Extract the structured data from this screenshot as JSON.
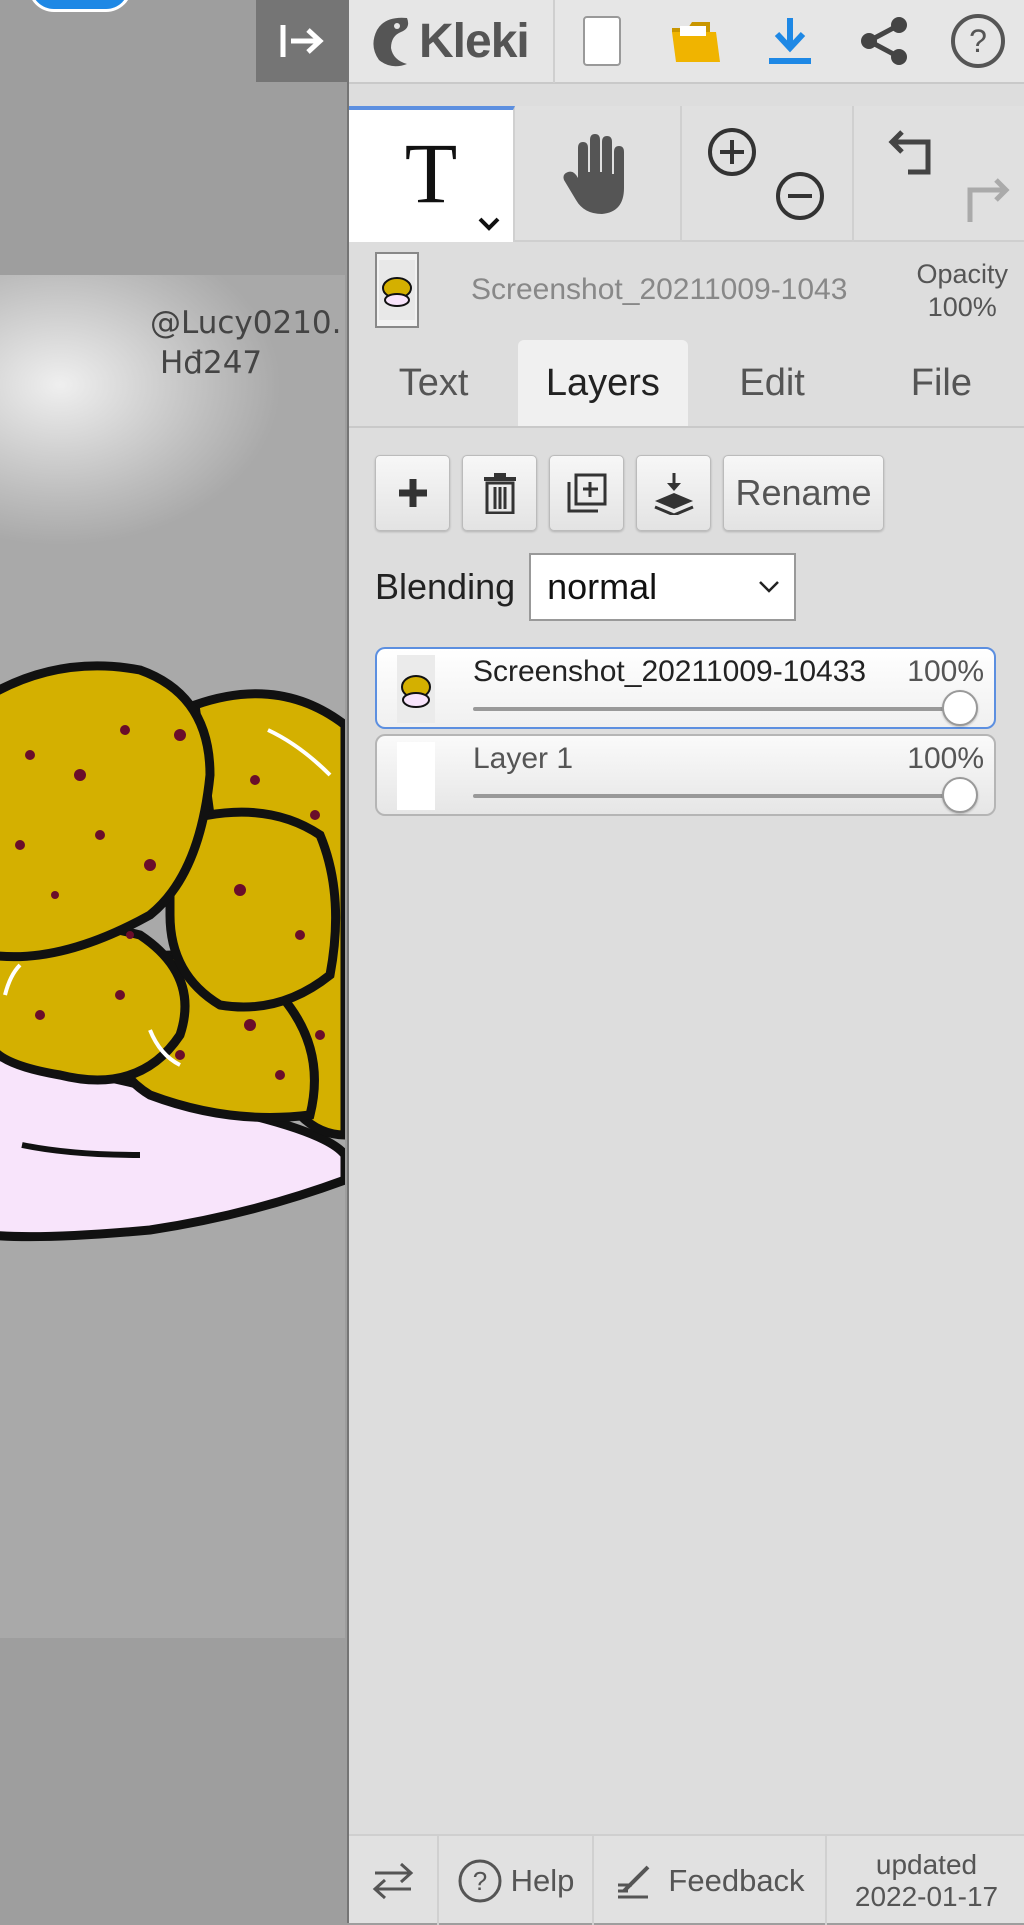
{
  "canvas": {
    "watermark_line1": "@Lucy0210.",
    "watermark_line2": "Hđ247"
  },
  "topbar": {
    "brand": "Kleki",
    "icons": [
      "new-image-icon",
      "open-folder-icon",
      "download-icon",
      "share-icon",
      "help-icon"
    ]
  },
  "tools": [
    "text-tool-icon",
    "hand-tool-icon",
    "zoom-in-icon",
    "zoom-out-icon",
    "undo-icon",
    "redo-icon"
  ],
  "tools_text_glyph": "T",
  "layer_header": {
    "name": "Screenshot_20211009-1043",
    "opacity_label": "Opacity",
    "opacity_value": "100%"
  },
  "tabs": [
    {
      "label": "Text",
      "active": false
    },
    {
      "label": "Layers",
      "active": true
    },
    {
      "label": "Edit",
      "active": false
    },
    {
      "label": "File",
      "active": false
    }
  ],
  "layer_tools": {
    "rename_label": "Rename"
  },
  "blending": {
    "label": "Blending",
    "value": "normal"
  },
  "layers": [
    {
      "name": "Screenshot_20211009-10433",
      "opacity": "100%",
      "level": 1.0,
      "selected": true
    },
    {
      "name": "Layer 1",
      "opacity": "100%",
      "level": 1.0,
      "selected": false
    }
  ],
  "footer": {
    "help_label": "Help",
    "feedback_label": "Feedback",
    "updated_line1": "updated",
    "updated_line2": "2022-01-17"
  },
  "colors": {
    "accent": "#5c8fe0",
    "folder": "#f0b400",
    "download": "#1e88e5",
    "hair": "#d4b000",
    "skin": "#f8e4fb"
  }
}
